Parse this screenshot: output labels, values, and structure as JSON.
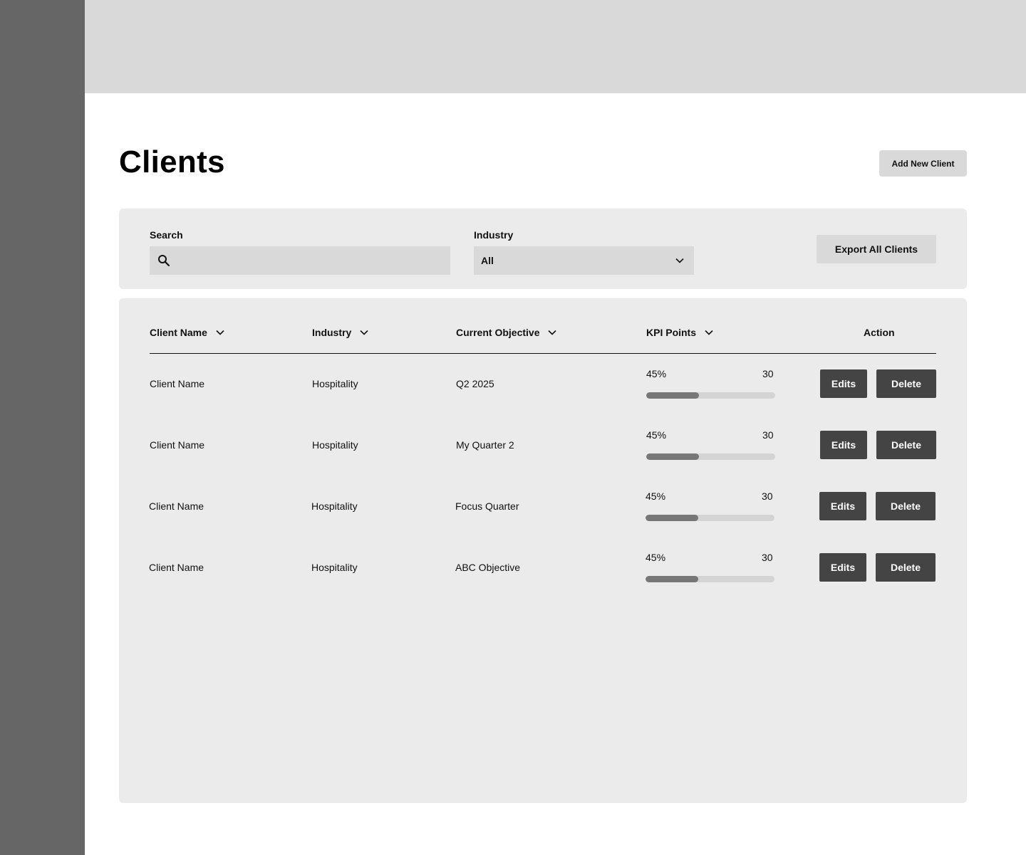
{
  "page": {
    "title": "Clients",
    "add_button": "Add New Client"
  },
  "filters": {
    "search_label": "Search",
    "search_value": "",
    "industry_label": "Industry",
    "industry_value": "All",
    "export_button": "Export All Clients"
  },
  "table": {
    "columns": [
      {
        "label": "Client Name",
        "sortable": true
      },
      {
        "label": "Industry",
        "sortable": true
      },
      {
        "label": "Current Objective",
        "sortable": true
      },
      {
        "label": "KPI Points",
        "sortable": true
      },
      {
        "label": "Action",
        "sortable": false
      }
    ],
    "rows": [
      {
        "client_name": "Client Name",
        "industry": "Hospitality",
        "objective": "Q2 2025",
        "kpi_percent_label": "45%",
        "kpi_progress": 0.41,
        "kpi_points": "30",
        "edit_label": "Edits",
        "delete_label": "Delete"
      },
      {
        "client_name": "Client Name",
        "industry": "Hospitality",
        "objective": "My Quarter 2",
        "kpi_percent_label": "45%",
        "kpi_progress": 0.41,
        "kpi_points": "30",
        "edit_label": "Edits",
        "delete_label": "Delete"
      },
      {
        "client_name": "Client Name",
        "industry": "Hospitality",
        "objective": "Focus Quarter",
        "kpi_percent_label": "45%",
        "kpi_progress": 0.41,
        "kpi_points": "30",
        "edit_label": "Edits",
        "delete_label": "Delete"
      },
      {
        "client_name": "Client Name",
        "industry": "Hospitality",
        "objective": "ABC Objective",
        "kpi_percent_label": "45%",
        "kpi_progress": 0.41,
        "kpi_points": "30",
        "edit_label": "Edits",
        "delete_label": "Delete"
      }
    ]
  },
  "icons": {
    "search": "search-icon",
    "dropdown": "chevron-down-icon",
    "sort": "chevron-down-icon"
  },
  "colors": {
    "sidebar": "#666666",
    "topbar": "#d9d9d9",
    "panel": "#ebebeb",
    "button_dark": "#444444",
    "progress_fill": "#777777",
    "progress_track": "#d4d4d4"
  }
}
